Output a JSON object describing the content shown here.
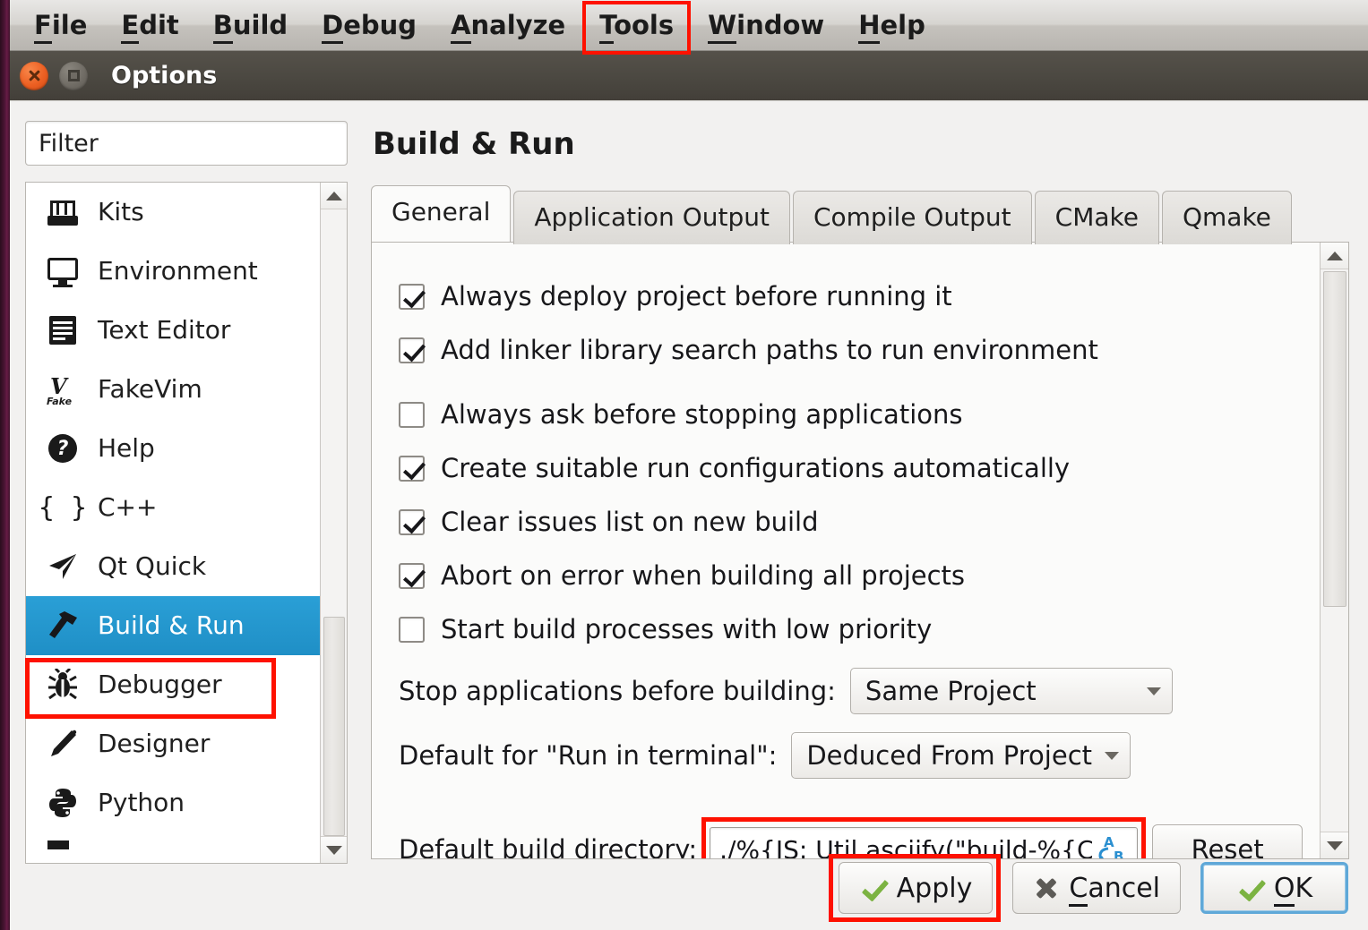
{
  "menubar": {
    "items": [
      {
        "label": "File",
        "accel": "F",
        "highlighted": false
      },
      {
        "label": "Edit",
        "accel": "E",
        "highlighted": false
      },
      {
        "label": "Build",
        "accel": "B",
        "highlighted": false
      },
      {
        "label": "Debug",
        "accel": "D",
        "highlighted": false
      },
      {
        "label": "Analyze",
        "accel": "A",
        "highlighted": false
      },
      {
        "label": "Tools",
        "accel": "T",
        "highlighted": true
      },
      {
        "label": "Window",
        "accel": "W",
        "highlighted": false
      },
      {
        "label": "Help",
        "accel": "H",
        "highlighted": false
      }
    ]
  },
  "titlebar": {
    "title": "Options",
    "close_icon": "close-icon",
    "maximize_icon": "maximize-icon"
  },
  "sidebar": {
    "filter": {
      "placeholder": "Filter",
      "value": ""
    },
    "items": [
      {
        "label": "Kits",
        "icon": "kits-icon",
        "selected": false
      },
      {
        "label": "Environment",
        "icon": "monitor-icon",
        "selected": false
      },
      {
        "label": "Text Editor",
        "icon": "document-lines-icon",
        "selected": false
      },
      {
        "label": "FakeVim",
        "icon": "fakevim-icon",
        "selected": false
      },
      {
        "label": "Help",
        "icon": "question-circle-icon",
        "selected": false
      },
      {
        "label": "C++",
        "icon": "braces-icon",
        "selected": false
      },
      {
        "label": "Qt Quick",
        "icon": "paper-plane-icon",
        "selected": false
      },
      {
        "label": "Build & Run",
        "icon": "hammer-icon",
        "selected": true
      },
      {
        "label": "Debugger",
        "icon": "bug-icon",
        "selected": false
      },
      {
        "label": "Designer",
        "icon": "pencil-icon",
        "selected": false
      },
      {
        "label": "Python",
        "icon": "python-icon",
        "selected": false
      }
    ],
    "scroll": {
      "up_icon": "scroll-up-arrow",
      "down_icon": "scroll-down-arrow"
    }
  },
  "page": {
    "title": "Build & Run",
    "tabs": [
      {
        "label": "General",
        "active": true
      },
      {
        "label": "Application Output",
        "active": false
      },
      {
        "label": "Compile Output",
        "active": false
      },
      {
        "label": "CMake",
        "active": false
      },
      {
        "label": "Qmake",
        "active": false
      }
    ],
    "checkboxes": [
      {
        "label": "Always deploy project before running it",
        "checked": true,
        "gap": false
      },
      {
        "label": "Add linker library search paths to run environment",
        "checked": true,
        "gap": false
      },
      {
        "label": "Always ask before stopping applications",
        "checked": false,
        "gap": true
      },
      {
        "label": "Create suitable run configurations automatically",
        "checked": true,
        "gap": false
      },
      {
        "label": "Clear issues list on new build",
        "checked": true,
        "gap": false
      },
      {
        "label": "Abort on error when building all projects",
        "checked": true,
        "gap": false
      },
      {
        "label": "Start build processes with low priority",
        "checked": false,
        "gap": false
      }
    ],
    "stop_applications": {
      "label": "Stop applications before building:",
      "value": "Same Project"
    },
    "run_in_terminal": {
      "label": "Default for \"Run in terminal\":",
      "value": "Deduced From Project"
    },
    "build_directory": {
      "label": "Default build directory:",
      "value": "./%{JS: Util.asciify(\"build-%{Cu",
      "variable_icon": "variable-ab-icon",
      "reset_label": "Reset"
    },
    "scroll": {
      "up_icon": "scroll-up-arrow",
      "down_icon": "scroll-down-arrow"
    }
  },
  "buttons": {
    "apply": {
      "label": "Apply",
      "icon": "green-check-icon",
      "highlighted": true
    },
    "cancel": {
      "label": "Cancel",
      "accel": "C",
      "icon": "gray-x-icon",
      "highlighted": false
    },
    "ok": {
      "label": "OK",
      "accel": "O",
      "icon": "green-check-icon",
      "default": true
    }
  },
  "annotations": {
    "color": "#fe1100",
    "targets": [
      "tools-menu",
      "build-and-run-sidebar-item",
      "default-build-directory-input",
      "apply-button"
    ]
  },
  "colors": {
    "accent_selection": "#1f8fc6",
    "annotation_red": "#fe1100",
    "titlebar": "#4b4841",
    "dialog_bg": "#f2f1f0",
    "panel_bg": "#fbfbfa",
    "check_green": "#7cb342"
  }
}
